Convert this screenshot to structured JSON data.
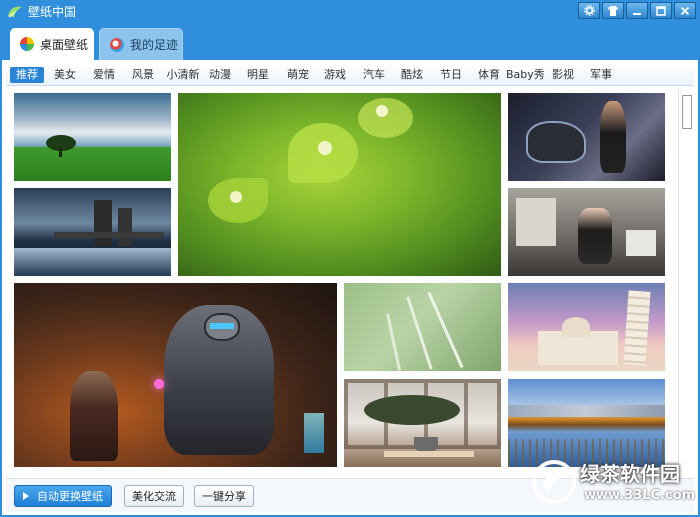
{
  "window": {
    "title": "壁纸中国",
    "controls": [
      "settings-icon",
      "skin-icon",
      "minimize-icon",
      "maximize-icon",
      "close-icon"
    ]
  },
  "top_tabs": [
    {
      "label": "桌面壁纸",
      "active": true,
      "icon": "desktop-wallpaper-icon"
    },
    {
      "label": "我的足迹",
      "active": false,
      "icon": "footprint-icon"
    }
  ],
  "categories": [
    {
      "label": "推荐",
      "active": true
    },
    {
      "label": "美女"
    },
    {
      "label": "爱情"
    },
    {
      "label": "风景"
    },
    {
      "label": "小清新"
    },
    {
      "label": "动漫"
    },
    {
      "label": "明星"
    },
    {
      "label": "萌宠"
    },
    {
      "label": "游戏"
    },
    {
      "label": "汽车"
    },
    {
      "label": "酷炫"
    },
    {
      "label": "节日"
    },
    {
      "label": "体育"
    },
    {
      "label": "Baby秀"
    },
    {
      "label": "影视"
    },
    {
      "label": "军事"
    }
  ],
  "wallpapers": [
    {
      "name": "tree-on-hill-wallpaper"
    },
    {
      "name": "castle-in-storm-wallpaper"
    },
    {
      "name": "green-plant-macro-wallpaper"
    },
    {
      "name": "motorcycle-model-wallpaper"
    },
    {
      "name": "woman-in-room-wallpaper"
    },
    {
      "name": "armored-robot-game-wallpaper"
    },
    {
      "name": "grass-stems-wallpaper"
    },
    {
      "name": "leaning-tower-pisa-wallpaper"
    },
    {
      "name": "bonsai-window-wallpaper"
    },
    {
      "name": "autumn-lake-wallpaper"
    }
  ],
  "bottom_bar": {
    "auto_change_label": "自动更换壁纸",
    "beautify_label": "美化交流",
    "share_label": "一键分享"
  },
  "watermark": {
    "text": "绿茶软件园",
    "url": "www.33LC.com"
  },
  "colors": {
    "window_blue": "#2f8fdc",
    "accent_blue": "#2b83d6",
    "tab_inactive": "#8cc4ee"
  }
}
